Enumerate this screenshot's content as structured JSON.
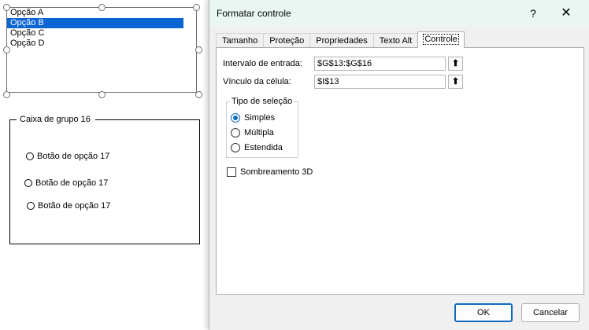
{
  "canvas": {
    "listbox": {
      "items": [
        "Opção A",
        "Opção B",
        "Opção C",
        "Opção D"
      ],
      "selected_index": 1
    },
    "group_box": {
      "title": "Caixa de grupo 16",
      "options": [
        "Botão de opção 17",
        "Botão de opção 17",
        "Botão de opção 17"
      ]
    }
  },
  "dialog": {
    "title": "Formatar controle",
    "help": "?",
    "close": "✕",
    "tabs": [
      "Tamanho",
      "Proteção",
      "Propriedades",
      "Texto Alt",
      "Controle"
    ],
    "active_tab": "Controle",
    "input_range": {
      "label": "Intervalo de entrada:",
      "value": "$G$13:$G$16"
    },
    "cell_link": {
      "label": "Vínculo da célula:",
      "value": "$I$13"
    },
    "collapse_glyph": "⬆",
    "selection_type": {
      "title": "Tipo de seleção",
      "options": [
        "Simples",
        "Múltipla",
        "Estendida"
      ],
      "selected": "Simples"
    },
    "shading_3d": {
      "label": "Sombreamento 3D",
      "checked": false
    },
    "ok_label": "OK",
    "cancel_label": "Cancelar"
  },
  "colors": {
    "accent": "#0f6cbd",
    "selection": "#0a64d2",
    "titlebar": "#e9f6f1"
  }
}
